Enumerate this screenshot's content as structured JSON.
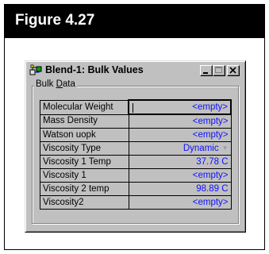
{
  "figure": {
    "label": "Figure 4.27"
  },
  "window": {
    "title": "Blend-1: Bulk Values",
    "icon": "flowsheet-icon",
    "controls": {
      "minimize": "minimize-icon",
      "maximize": "maximize-icon",
      "close": "close-icon"
    }
  },
  "group": {
    "label_prefix": "Bulk ",
    "label_mnemonic": "D",
    "label_suffix": "ata"
  },
  "rows": [
    {
      "label": "Molecular Weight",
      "value": "<empty>"
    },
    {
      "label": "Mass Density",
      "value": "<empty>"
    },
    {
      "label": "Watson uopk",
      "value": "<empty>"
    },
    {
      "label": "Viscosity Type",
      "value": "Dynamic"
    },
    {
      "label": "Viscosity 1 Temp",
      "value": "37.78 C"
    },
    {
      "label": "Viscosity 1",
      "value": "<empty>"
    },
    {
      "label": "Viscosity 2 temp",
      "value": "98.89 C"
    },
    {
      "label": "Viscosity2",
      "value": "<empty>"
    }
  ],
  "colors": {
    "value_text": "#1010ff",
    "header_bg": "#000000",
    "window_bg": "#c0c0c0"
  }
}
